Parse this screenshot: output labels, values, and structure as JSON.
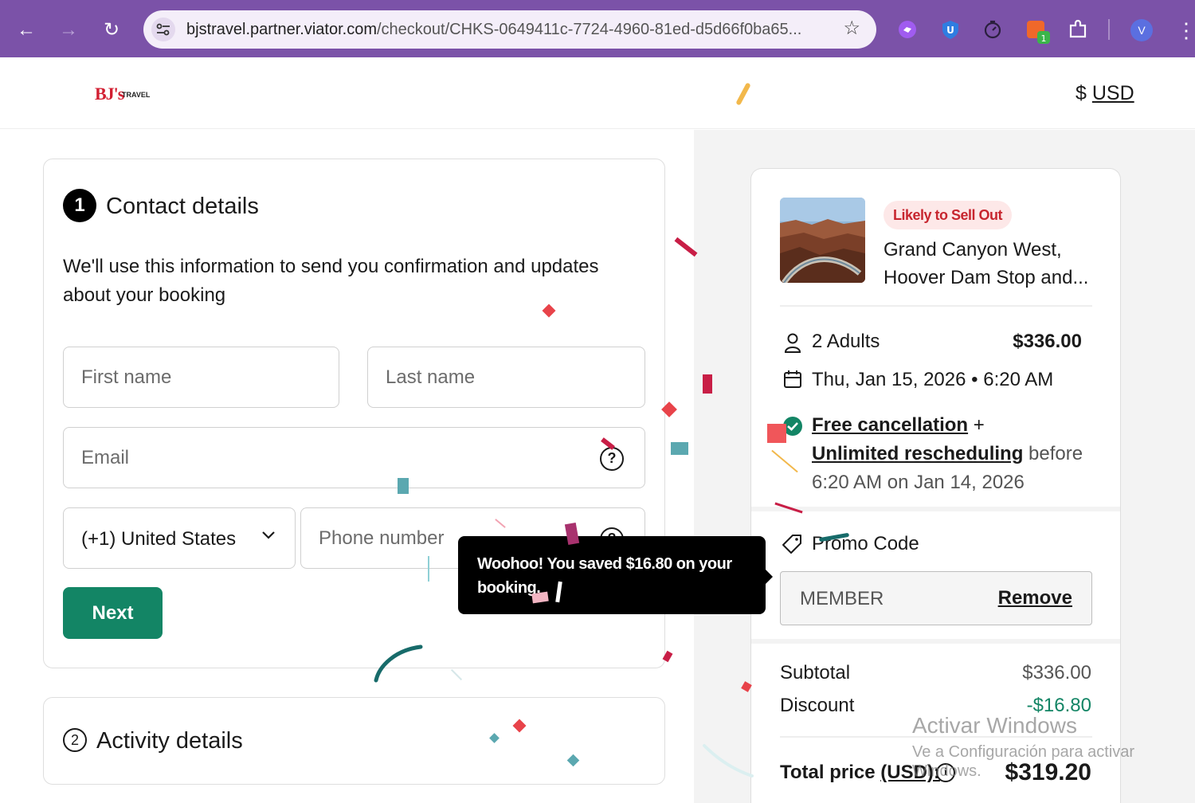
{
  "browser": {
    "url_host": "bjstravel.partner.viator.com",
    "url_path": "/checkout/CHKS-0649411c-7724-4960-81ed-d5d66f0ba65...",
    "profile_initial": "V",
    "extension_badge": "1"
  },
  "header": {
    "logo_text": "BJ's",
    "logo_subtext": "TRAVEL",
    "currency_symbol": "$",
    "currency_code": "USD"
  },
  "contact": {
    "step": "1",
    "title": "Contact details",
    "description": "We'll use this information to send you confirmation and updates about your booking",
    "first_name_placeholder": "First name",
    "last_name_placeholder": "Last name",
    "email_placeholder": "Email",
    "help_glyph": "?",
    "country_value": "(+1) United States",
    "phone_placeholder": "Phone number",
    "next_label": "Next"
  },
  "activity": {
    "step": "2",
    "title": "Activity details"
  },
  "toast": {
    "message": "Woohoo! You saved $16.80 on your booking."
  },
  "summary": {
    "badge": "Likely to Sell Out",
    "tour_title": "Grand Canyon West, Hoover Dam Stop and...",
    "travelers": "2 Adults",
    "travelers_price": "$336.00",
    "date_time": "Thu, Jan 15, 2026 • 6:20 AM",
    "cancel_free": "Free cancellation",
    "cancel_plus": "+",
    "cancel_resched": "Unlimited rescheduling",
    "cancel_before": "before",
    "cancel_deadline": "6:20 AM on Jan 14, 2026",
    "promo_label": "Promo Code",
    "promo_value": "MEMBER",
    "promo_remove": "Remove",
    "subtotal_label": "Subtotal",
    "subtotal_value": "$336.00",
    "discount_label": "Discount",
    "discount_value": "-$16.80",
    "total_label": "Total price",
    "total_currency": "(USD):",
    "total_value": "$319.20"
  },
  "watermark": {
    "title": "Activar Windows",
    "subtitle": "Ve a Configuración para activar Windows."
  },
  "colors": {
    "browser_frame": "#7b52a8",
    "brand_green": "#138565",
    "sellout_red": "#c7262f",
    "logo_red": "#d21f32"
  },
  "icons": {
    "back": "arrow-left-icon",
    "forward": "arrow-right-icon",
    "reload": "reload-icon",
    "site_settings": "tune-icon",
    "bookmark": "star-icon",
    "person": "person-icon",
    "calendar": "calendar-icon",
    "check": "check-circle-icon",
    "tag": "tag-icon",
    "info": "info-icon"
  }
}
